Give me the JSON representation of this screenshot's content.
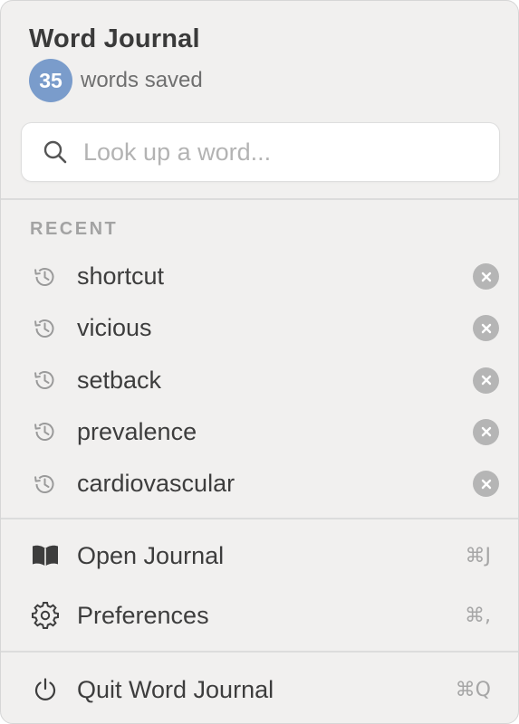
{
  "app": {
    "title": "Word Journal",
    "saved_count": "35",
    "saved_label": "words saved",
    "accent_color": "#7a9ccb"
  },
  "search": {
    "placeholder": "Look up a word...",
    "value": "",
    "icon": "search-icon"
  },
  "recent": {
    "label": "RECENT",
    "items": [
      {
        "word": "shortcut",
        "icon": "history-icon",
        "action_icon": "clear-icon"
      },
      {
        "word": "vicious",
        "icon": "history-icon",
        "action_icon": "clear-icon"
      },
      {
        "word": "setback",
        "icon": "history-icon",
        "action_icon": "clear-icon"
      },
      {
        "word": "prevalence",
        "icon": "history-icon",
        "action_icon": "clear-icon"
      },
      {
        "word": "cardiovascular",
        "icon": "history-icon",
        "action_icon": "clear-icon"
      }
    ]
  },
  "menu": {
    "open_journal": {
      "label": "Open Journal",
      "shortcut": "⌘J",
      "icon": "book-icon"
    },
    "preferences": {
      "label": "Preferences",
      "shortcut": "⌘,",
      "icon": "gear-icon"
    },
    "quit": {
      "label": "Quit Word Journal",
      "shortcut": "⌘Q",
      "icon": "power-icon"
    }
  }
}
